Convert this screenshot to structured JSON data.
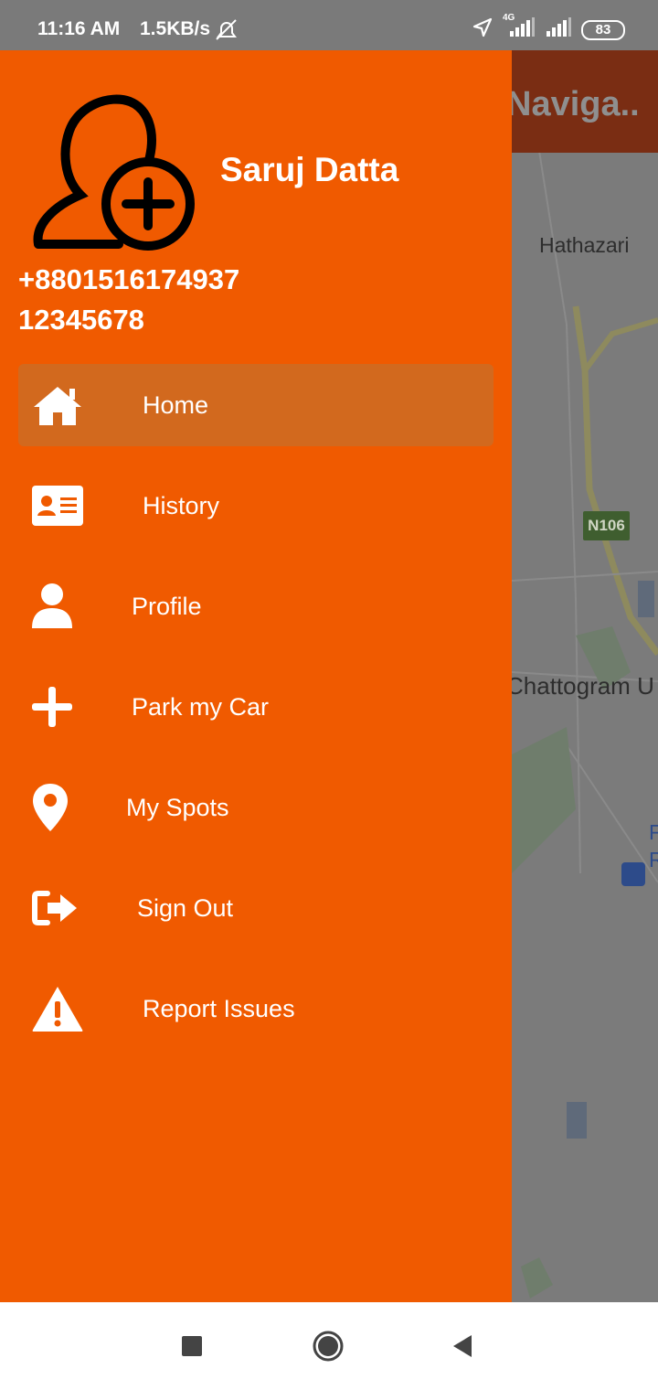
{
  "status_bar": {
    "time": "11:16 AM",
    "speed": "1.5KB/s",
    "network_badge": "4G",
    "battery": "83"
  },
  "background": {
    "appbar_title": "Naviga..",
    "map_labels": [
      "Hathazari",
      "Chattogram U",
      "F",
      "R"
    ],
    "road_shield": "N106"
  },
  "drawer": {
    "user_name": "Saruj Datta",
    "phone": "+8801516174937",
    "code": "12345678",
    "menu": [
      {
        "label": "Home",
        "icon": "home-icon",
        "active": true
      },
      {
        "label": "History",
        "icon": "id-card-icon",
        "active": false
      },
      {
        "label": "Profile",
        "icon": "user-icon",
        "active": false
      },
      {
        "label": "Park my Car",
        "icon": "plus-icon",
        "active": false
      },
      {
        "label": "My Spots",
        "icon": "location-pin-icon",
        "active": false
      },
      {
        "label": "Sign Out",
        "icon": "sign-out-icon",
        "active": false
      },
      {
        "label": "Report Issues",
        "icon": "warning-icon",
        "active": false
      }
    ]
  },
  "colors": {
    "drawer_bg": "#f05a00",
    "active_item_bg": "#d2691e",
    "status_bar_bg": "#7a7a7a",
    "text": "#ffffff"
  }
}
